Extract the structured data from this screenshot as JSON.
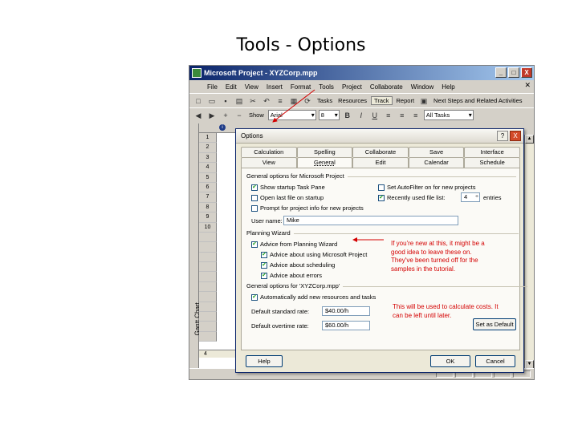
{
  "slide": {
    "title": "Tools - Options"
  },
  "app": {
    "title": "Microsoft Project - XYZCorp.mpp",
    "window_buttons": [
      "_",
      "□",
      "X"
    ],
    "menu": [
      "File",
      "Edit",
      "View",
      "Insert",
      "Format",
      "Tools",
      "Project",
      "Collaborate",
      "Window",
      "Help"
    ],
    "menu_close": "✕",
    "toolbar1_text": [
      "Tasks",
      "Resources",
      "Track",
      "Report"
    ],
    "next_steps_label": "Next Steps and Related Activities",
    "toolbar2": {
      "show_label": "Show",
      "font_value": "Arial",
      "size_value": "8",
      "bold": "B",
      "italic": "I",
      "underline": "U",
      "filter_value": "All Tasks"
    },
    "vertical_label": "Gantt Chart",
    "row_numbers": [
      "1",
      "2",
      "3",
      "4",
      "5",
      "6",
      "7",
      "8",
      "9",
      "10"
    ],
    "info_icon": "i",
    "scroll_indicator": "4"
  },
  "dialog": {
    "title": "Options",
    "help_btn": "?",
    "close_btn": "X",
    "tabs_row1": [
      "Calculation",
      "Spelling",
      "Collaborate",
      "Save",
      "Interface"
    ],
    "tabs_row2": [
      "View",
      "General",
      "Edit",
      "Calendar",
      "Schedule"
    ],
    "active_tab": "General",
    "section_general_project": "General options for Microsoft Project",
    "chk_show_startup": "Show startup Task Pane",
    "chk_open_last": "Open last file on startup",
    "chk_prompt_info": "Prompt for project info for new projects",
    "chk_autofilter": "Set AutoFilter on for new projects",
    "chk_recent": "Recently used file list:",
    "recent_count": "4",
    "recent_suffix": "entries",
    "user_name_label": "User name:",
    "user_name_value": "Mike",
    "section_planning": "Planning Wizard",
    "chk_advice_wizard": "Advice from Planning Wizard",
    "chk_advice_using": "Advice about using Microsoft Project",
    "chk_advice_scheduling": "Advice about scheduling",
    "chk_advice_errors": "Advice about errors",
    "section_general_file": "General options for 'XYZCorp.mpp'",
    "chk_auto_add": "Automatically add new resources and tasks",
    "std_rate_label": "Default standard rate:",
    "std_rate_value": "$40.00/h",
    "ovt_rate_label": "Default overtime rate:",
    "ovt_rate_value": "$60.00/h",
    "set_default_btn": "Set as Default",
    "help_button": "Help",
    "ok_button": "OK",
    "cancel_button": "Cancel"
  },
  "notes": {
    "planning": "If you're new at this, it might be a good idea to leave these on. They've been turned off for the samples in the tutorial.",
    "rates": "This will be used to calculate costs. It can be left until later."
  },
  "colors": {
    "annotation": "#d40000",
    "titlebar": "#0a246a",
    "check": "#21a121"
  }
}
